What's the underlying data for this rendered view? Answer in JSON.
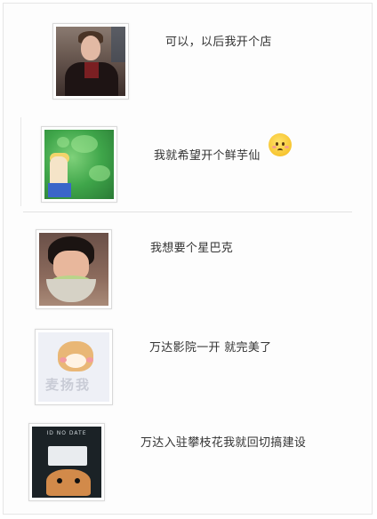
{
  "chat": {
    "items": [
      {
        "caption": "可以，以后我开个店",
        "thumb_icon": "photo-young-man"
      },
      {
        "caption": "我就希望开个鲜芋仙",
        "thumb_icon": "photo-anime-girl",
        "emoji": "blushing-face-emoji"
      },
      {
        "caption": "我想要个星巴克",
        "thumb_icon": "photo-child-eating"
      },
      {
        "caption": "万达影院一开 就完美了",
        "thumb_icon": "photo-shiba-meme",
        "thumb_text": "麦扬我"
      },
      {
        "caption": "万达入驻攀枝花我就回切搞建设",
        "thumb_icon": "photo-id-card-shiba",
        "thumb_header": "ID NO    DATE"
      }
    ]
  }
}
